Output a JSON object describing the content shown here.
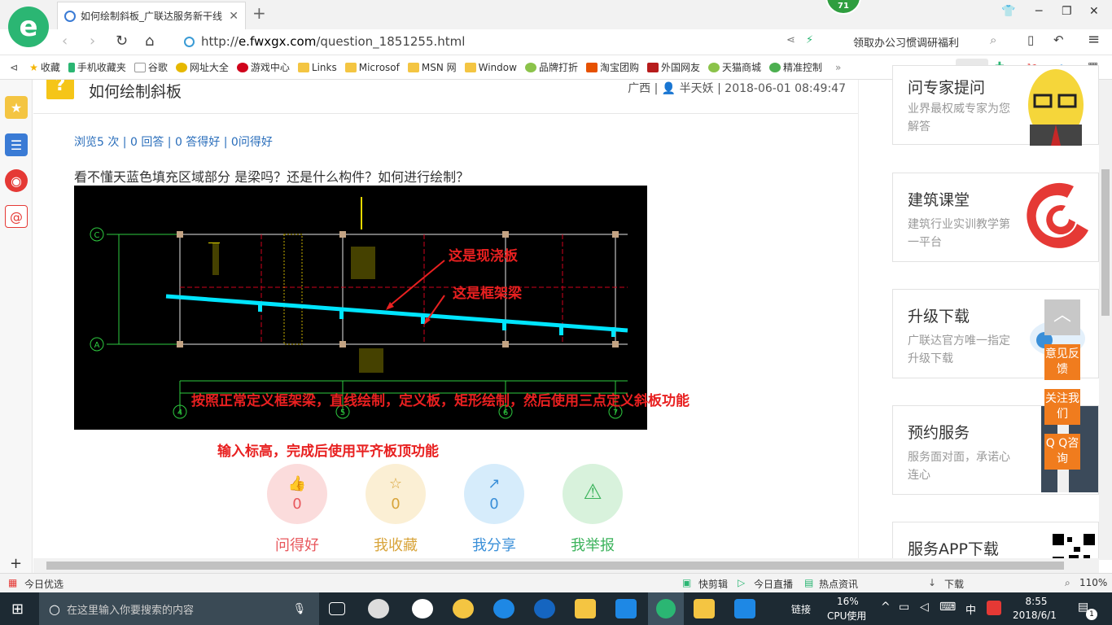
{
  "tab": {
    "title": "如何绘制斜板_广联达服务新干线"
  },
  "badge": "71",
  "address": {
    "protocol": "http://",
    "domain": "e.fwxgx.com",
    "path": "/question_1851255.html",
    "right_text": "领取办公习惯调研福利"
  },
  "bookmarks": [
    "收藏",
    "手机收藏夹",
    "谷歌",
    "网址大全",
    "游戏中心",
    "Links",
    "Microsof",
    "MSN 网",
    "Window",
    "品牌打折",
    "淘宝团购",
    "外国网友",
    "天猫商城",
    "精准控制"
  ],
  "question": {
    "title": "如何绘制斜板",
    "meta": "广西 | 👤 半天妖 | 2018-06-01 08:49:47",
    "stats": "浏览5 次 | 0 回答 | 0 答得好 | 0问得好",
    "description": "看不懂天蓝色填充区域部分    是梁吗？还是什么构件？如何进行绘制？"
  },
  "cad": {
    "label_slab": "这是现浇板",
    "label_beam": "这是框架梁",
    "axis_labels": [
      "C",
      "A",
      "4",
      "5",
      "6",
      "7"
    ]
  },
  "notes": {
    "line1": "按照正常定义框架梁，直线绘制，定义板，矩形绘制，然后使用三点定义斜板功能",
    "line2": "输入标高，完成后使用平齐板顶功能"
  },
  "actions": [
    {
      "label": "问得好",
      "count": "0",
      "color": "#e8575c",
      "bg": "#fbdcdc"
    },
    {
      "label": "我收藏",
      "count": "0",
      "color": "#d8a43a",
      "bg": "#fbefd4"
    },
    {
      "label": "我分享",
      "count": "0",
      "color": "#3a8fd8",
      "bg": "#d6ecfb"
    },
    {
      "label": "我举报",
      "count": "",
      "color": "#3cb35c",
      "bg": "#d8f2dc"
    }
  ],
  "right_cards": [
    {
      "title": "问专家提问",
      "sub": "业界最权威专家为您解答"
    },
    {
      "title": "建筑课堂",
      "sub": "建筑行业实训教学第一平台"
    },
    {
      "title": "升级下载",
      "sub": "广联达官方唯一指定升级下载"
    },
    {
      "title": "预约服务",
      "sub": "服务面对面，承诺心连心"
    },
    {
      "title": "服务APP下载",
      "sub": ""
    }
  ],
  "float_buttons": [
    "意见反馈",
    "关注我们",
    "Q Q咨询"
  ],
  "statusbar": {
    "left": "今日优选",
    "items": [
      "快剪辑",
      "今日直播",
      "热点资讯",
      "下载"
    ],
    "zoom": "110%"
  },
  "taskbar": {
    "search_placeholder": "在这里输入你要搜索的内容",
    "cpu_percent": "16%",
    "cpu_label": "CPU使用",
    "link_label": "链接",
    "ime": "中",
    "time": "8:55",
    "date": "2018/6/1",
    "notifications": "1"
  }
}
